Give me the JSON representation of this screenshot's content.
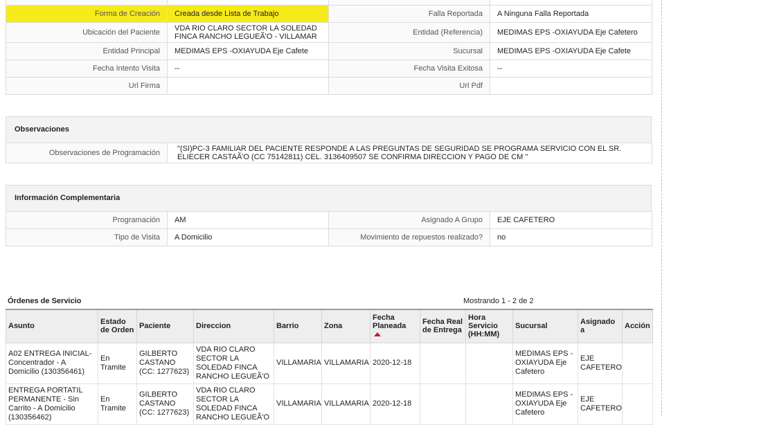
{
  "detail": {
    "rows": [
      {
        "l1": "Forma de Creación",
        "v1": "Creada desde Lista de Trabajo",
        "l2": "Falla Reportada",
        "v2": "A Ninguna Falla Reportada"
      },
      {
        "l1": "Ubicación del Paciente",
        "v1": "VDA RIO CLARO SECTOR LA SOLEDAD FINCA RANCHO LEGUEÃ'O - VILLAMAR",
        "l2": "Entidad (Referencia)",
        "v2": "MEDIMAS EPS -OXIAYUDA Eje Cafetero"
      },
      {
        "l1": "Entidad Principal",
        "v1": "MEDIMAS EPS -OXIAYUDA Eje Cafete",
        "l2": "Sucursal",
        "v2": "MEDIMAS EPS -OXIAYUDA Eje Cafete"
      },
      {
        "l1": "Fecha Intento Visita",
        "v1": "--",
        "l2": "Fecha Visita Exitosa",
        "v2": "--"
      },
      {
        "l1": "Url Firma",
        "v1": "",
        "l2": "Url Pdf",
        "v2": ""
      }
    ]
  },
  "observaciones": {
    "title": "Observaciones",
    "label": "Observaciones de Programación",
    "value": "\"(SI)PC-3 FAMILIAR DEL PACIENTE RESPONDE A LAS PREGUNTAS DE SEGURIDAD SE PROGRAMA SERVICIO CON EL SR. ELIECER CASTAÃ'O (CC 75142811) CEL. 3136409507 SE CONFIRMA DIRECCION Y PAGO DE CM \""
  },
  "complementaria": {
    "title": "Información Complementaria",
    "rows": [
      {
        "l1": "Programación",
        "v1": "AM",
        "l2": "Asignado A Grupo",
        "v2": "EJE CAFETERO"
      },
      {
        "l1": "Tipo de Visita",
        "v1": "A Domicilio",
        "l2": "Movimiento de repuestos realizado?",
        "v2": "no"
      }
    ]
  },
  "ordenes": {
    "title": "Órdenes de Servicio",
    "showing": "Mostrando 1 - 2 de 2",
    "headers": {
      "asunto": "Asunto",
      "estado": "Estado de Orden",
      "paciente": "Paciente",
      "direccion": "Direccion",
      "barrio": "Barrio",
      "zona": "Zona",
      "fecha_planeada": "Fecha Planeada",
      "fecha_real": "Fecha Real de Entrega",
      "hora": "Hora Servicio (HH:MM)",
      "sucursal": "Sucursal",
      "asignado": "Asignado a",
      "accion": "Acción"
    },
    "rows": [
      {
        "asunto": "A02 ENTREGA INICIAL-Concentrador - A Domicilio (130356461)",
        "estado": "En Tramite",
        "paciente": "GILBERTO CASTANO (CC: 1277623)",
        "direccion": "VDA RIO CLARO SECTOR LA SOLEDAD FINCA RANCHO LEGUEÃ'O",
        "barrio": "VILLAMARIA",
        "zona": "VILLAMARIA",
        "fecha_planeada": "2020-12-18",
        "fecha_real": "",
        "hora": "",
        "sucursal": "MEDIMAS EPS -OXIAYUDA Eje Cafetero",
        "asignado": "EJE CAFETERO",
        "accion": ""
      },
      {
        "asunto": "ENTREGA PORTATIL PERMANENTE - Sin Carrito - A Domicilio (130356462)",
        "estado": "En Tramite",
        "paciente": "GILBERTO CASTANO (CC: 1277623)",
        "direccion": "VDA RIO CLARO SECTOR LA SOLEDAD FINCA RANCHO LEGUEÃ'O",
        "barrio": "VILLAMARIA",
        "zona": "VILLAMARIA",
        "fecha_planeada": "2020-12-18",
        "fecha_real": "",
        "hora": "",
        "sucursal": "MEDIMAS EPS -OXIAYUDA Eje Cafetero",
        "asignado": "EJE CAFETERO",
        "accion": ""
      }
    ]
  }
}
